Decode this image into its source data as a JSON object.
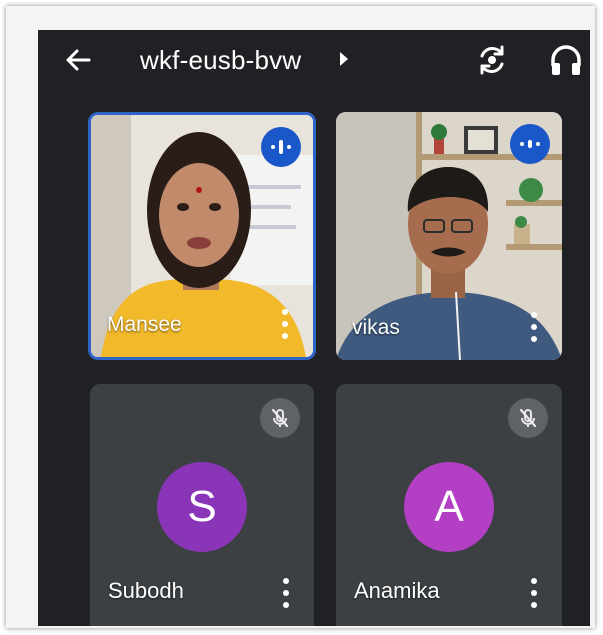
{
  "header": {
    "meeting_code": "wkf-eusb-bvw",
    "icons": [
      "back-arrow-icon",
      "camera-switch-icon",
      "headphones-icon"
    ]
  },
  "participants": [
    {
      "name": "Mansee",
      "status": "speaking",
      "video": true
    },
    {
      "name": "vikas",
      "status": "speaking",
      "video": true
    },
    {
      "name": "Subodh",
      "status": "muted",
      "video": false,
      "initial": "S",
      "avatar_color": "#8a35b8"
    },
    {
      "name": "Anamika",
      "status": "muted",
      "video": false,
      "initial": "A",
      "avatar_color": "#b33fc4"
    }
  ],
  "colors": {
    "background": "#202124",
    "tile": "#3c4043",
    "active_speaker_border": "#2e63c8",
    "speaking_badge": "#1a57c8",
    "muted_badge": "#5f6368"
  }
}
